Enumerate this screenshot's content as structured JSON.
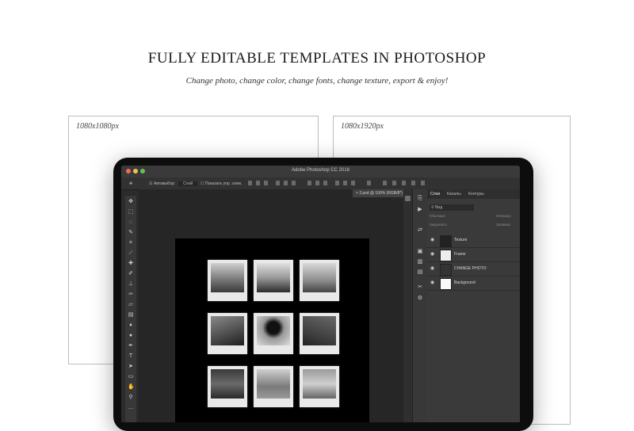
{
  "header": {
    "title": "FULLY EDITABLE TEMPLATES IN PHOTOSHOP",
    "subtitle": "Change photo, change color, change fonts, change texture, export & enjoy!"
  },
  "frames": [
    {
      "size_label": "1080x1080px"
    },
    {
      "size_label": "1080x1920px"
    }
  ],
  "photoshop": {
    "app_title": "Adobe Photoshop CC 2018",
    "options": {
      "autoselect_label": "Автовыбор:",
      "layer_select": "Слой",
      "show_controls": "Показать упр. элем."
    },
    "document_tab": "2.psd @ 100% (RGB/8*)",
    "panel": {
      "tabs": [
        "Слои",
        "Каналы",
        "Контуры"
      ],
      "filter_label": "Вид",
      "blend_mode": "Обычные",
      "opacity_label": "Непрозр.:",
      "lock_label": "Закрепить:",
      "fill_label": "Заливка:",
      "layers": [
        {
          "name": "Texture"
        },
        {
          "name": "Frame"
        },
        {
          "name": "CHANGE PHOTO"
        },
        {
          "name": "Background"
        }
      ]
    }
  },
  "colors": {
    "accent_traffic": [
      "#ed6a5e",
      "#f5bf4f",
      "#61c454"
    ],
    "ui_dark": "#2b2b2b"
  },
  "icons": {
    "tools": [
      "move-icon",
      "marquee-icon",
      "lasso-icon",
      "quick-select-icon",
      "crop-icon",
      "eyedropper-icon",
      "healing-icon",
      "brush-icon",
      "stamp-icon",
      "history-brush-icon",
      "eraser-icon",
      "gradient-icon",
      "blur-icon",
      "dodge-icon",
      "pen-icon",
      "type-icon",
      "path-select-icon",
      "shape-icon",
      "hand-icon",
      "zoom-icon"
    ]
  }
}
